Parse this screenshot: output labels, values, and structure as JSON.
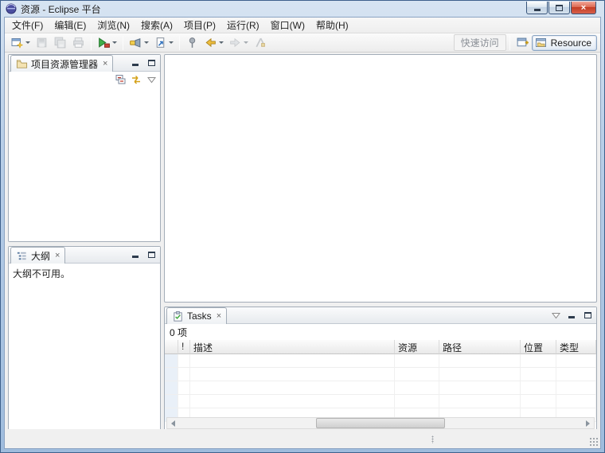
{
  "window": {
    "title": "资源 - Eclipse 平台"
  },
  "menubar": {
    "items": [
      "文件(F)",
      "编辑(E)",
      "浏览(N)",
      "搜索(A)",
      "项目(P)",
      "运行(R)",
      "窗口(W)",
      "帮助(H)"
    ]
  },
  "toolbar": {
    "quick_access": "快速访问",
    "perspective": "Resource"
  },
  "project_explorer": {
    "title": "项目资源管理器"
  },
  "outline": {
    "title": "大纲",
    "message": "大纲不可用。"
  },
  "tasks": {
    "title": "Tasks",
    "count": "0 项",
    "columns": [
      "",
      "!",
      "描述",
      "资源",
      "路径",
      "位置",
      "类型"
    ]
  }
}
